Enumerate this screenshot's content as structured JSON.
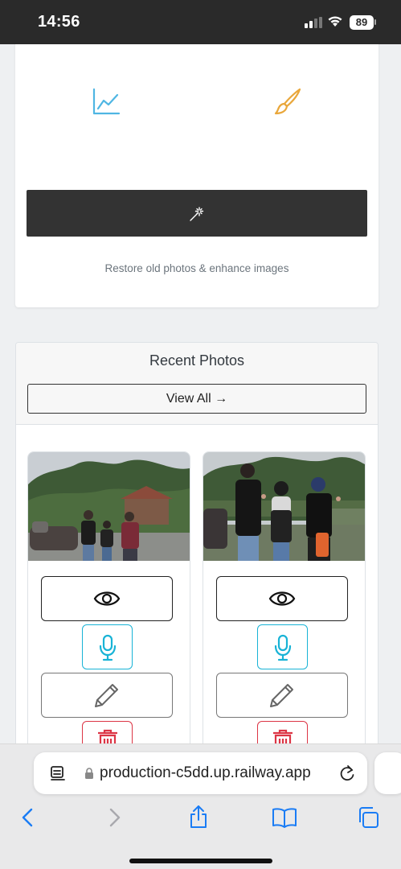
{
  "status_bar": {
    "time": "14:56",
    "battery": "89"
  },
  "hero": {
    "left_icon": "chart-line-icon",
    "right_icon": "paintbrush-icon",
    "button_icon": "magic-wand-icon",
    "tagline": "Restore old photos & enhance images"
  },
  "recent": {
    "title": "Recent Photos",
    "view_all_label": "View All →",
    "photos": [
      {
        "actions": [
          "eye-icon",
          "microphone-icon",
          "pencil-icon",
          "trash-icon"
        ]
      },
      {
        "actions": [
          "eye-icon",
          "microphone-icon",
          "pencil-icon",
          "trash-icon"
        ]
      }
    ]
  },
  "browser": {
    "url": "production-c5dd.up.railway.app",
    "toolbar": [
      "back-icon",
      "forward-icon",
      "share-icon",
      "bookmarks-icon",
      "tabs-icon"
    ]
  },
  "colors": {
    "accent_chart": "#4fb6e3",
    "accent_brush": "#e9a73b",
    "mic": "#18b3d6",
    "delete": "#dc3545",
    "ios_blue": "#1a7cf5",
    "dark_button": "#333333"
  }
}
